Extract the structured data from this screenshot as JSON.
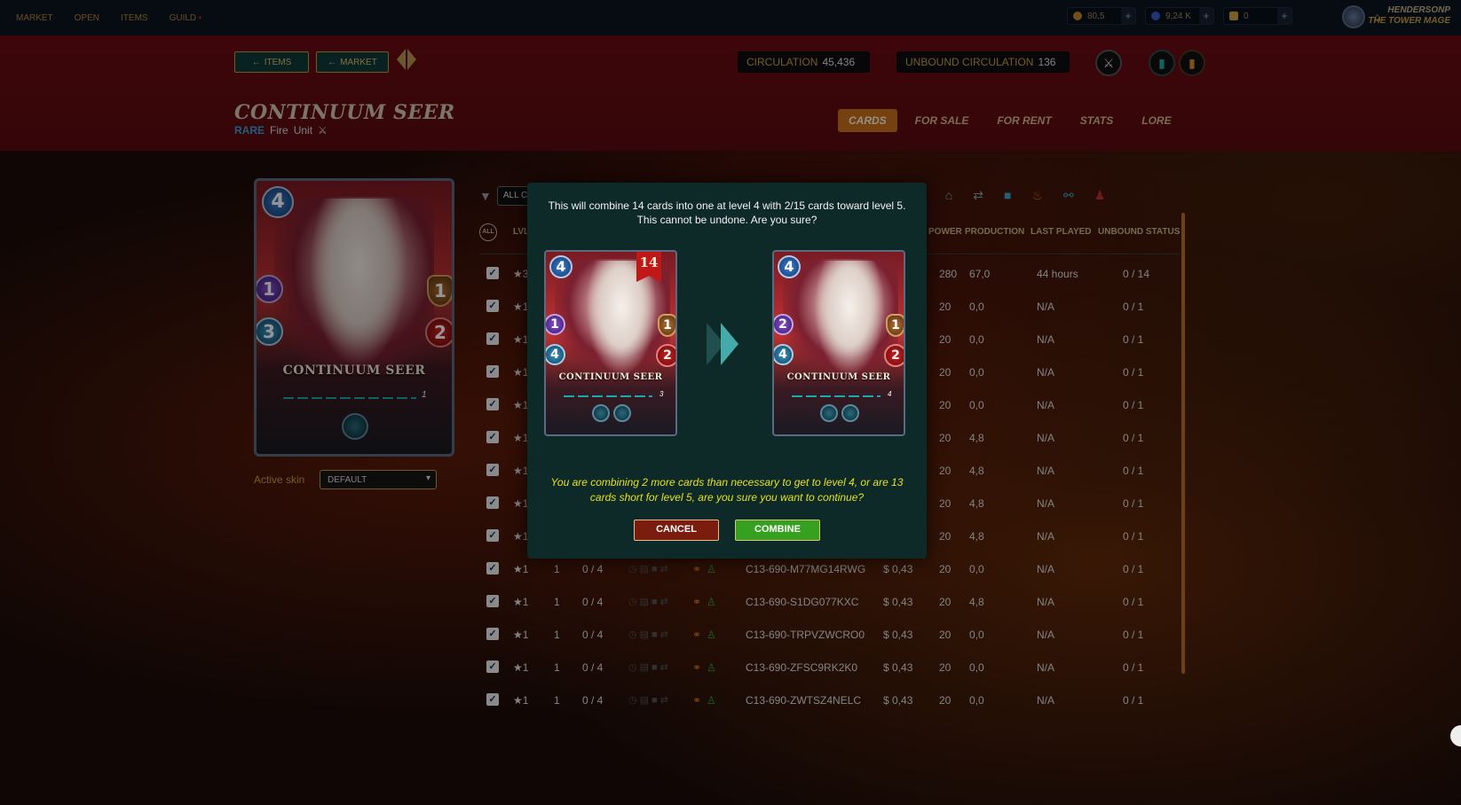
{
  "nav": {
    "items": [
      "MARKET",
      "OPEN",
      "ITEMS",
      "GUILD"
    ],
    "guild_dot": "•"
  },
  "currencies": [
    {
      "value": "80,5",
      "color": "#c8842a"
    },
    {
      "value": "9,24 K",
      "color": "#3a5ad0"
    },
    {
      "value": "0",
      "color": "#d0a040"
    }
  ],
  "user": {
    "name": "HENDERSONP",
    "title": "THE TOWER MAGE"
  },
  "header": {
    "items_button": "ITEMS",
    "market_button": "MARKET",
    "circulation_label": "CIRCULATION",
    "circulation_value": "45,436",
    "unbound_label": "UNBOUND CIRCULATION",
    "unbound_value": "136"
  },
  "card": {
    "name": "CONTINUUM SEER",
    "rarity": "RARE",
    "element": "Fire",
    "type": "Unit",
    "mana": "4",
    "magic": "1",
    "armor": "1",
    "health": "2",
    "speed": "3",
    "level": "1"
  },
  "tabs": [
    "CARDS",
    "FOR SALE",
    "FOR RENT",
    "STATS",
    "LORE"
  ],
  "active_tab": "CARDS",
  "skin": {
    "label": "Active skin",
    "value": "DEFAULT"
  },
  "table": {
    "filter_value": "ALL C",
    "all_label": "ALL",
    "columns": {
      "lvl": "LVL",
      "power": "POWER",
      "production": "PRODUCTION",
      "last_played": "LAST PLAYED",
      "unbound_status": "UNBOUND STATUS"
    },
    "rows": [
      {
        "stars": "★3",
        "lvl": "",
        "xp": "",
        "uid": "",
        "price": "",
        "power": "280",
        "production": "67,0",
        "last_played": "44 hours",
        "unbound": "0 / 14"
      },
      {
        "stars": "★1",
        "lvl": "",
        "xp": "",
        "uid": "",
        "price": "",
        "power": "20",
        "production": "0,0",
        "last_played": "N/A",
        "unbound": "0 / 1"
      },
      {
        "stars": "★1",
        "lvl": "",
        "xp": "",
        "uid": "",
        "price": "",
        "power": "20",
        "production": "0,0",
        "last_played": "N/A",
        "unbound": "0 / 1"
      },
      {
        "stars": "★1",
        "lvl": "",
        "xp": "",
        "uid": "",
        "price": "",
        "power": "20",
        "production": "0,0",
        "last_played": "N/A",
        "unbound": "0 / 1"
      },
      {
        "stars": "★1",
        "lvl": "",
        "xp": "",
        "uid": "",
        "price": "",
        "power": "20",
        "production": "0,0",
        "last_played": "N/A",
        "unbound": "0 / 1"
      },
      {
        "stars": "★1",
        "lvl": "",
        "xp": "",
        "uid": "",
        "price": "",
        "power": "20",
        "production": "4,8",
        "last_played": "N/A",
        "unbound": "0 / 1"
      },
      {
        "stars": "★1",
        "lvl": "",
        "xp": "",
        "uid": "",
        "price": "",
        "power": "20",
        "production": "4,8",
        "last_played": "N/A",
        "unbound": "0 / 1"
      },
      {
        "stars": "★1",
        "lvl": "",
        "xp": "",
        "uid": "",
        "price": "",
        "power": "20",
        "production": "4,8",
        "last_played": "N/A",
        "unbound": "0 / 1"
      },
      {
        "stars": "★1",
        "lvl": "",
        "xp": "",
        "uid": "",
        "price": "",
        "power": "20",
        "production": "4,8",
        "last_played": "N/A",
        "unbound": "0 / 1"
      },
      {
        "stars": "★1",
        "lvl": "1",
        "xp": "0 / 4",
        "uid": "C13-690-M77MG14RWG",
        "price": "$ 0,43",
        "power": "20",
        "production": "0,0",
        "last_played": "N/A",
        "unbound": "0 / 1"
      },
      {
        "stars": "★1",
        "lvl": "1",
        "xp": "0 / 4",
        "uid": "C13-690-S1DG077KXC",
        "price": "$ 0,43",
        "power": "20",
        "production": "4,8",
        "last_played": "N/A",
        "unbound": "0 / 1"
      },
      {
        "stars": "★1",
        "lvl": "1",
        "xp": "0 / 4",
        "uid": "C13-690-TRPVZWCRO0",
        "price": "$ 0,43",
        "power": "20",
        "production": "0,0",
        "last_played": "N/A",
        "unbound": "0 / 1"
      },
      {
        "stars": "★1",
        "lvl": "1",
        "xp": "0 / 4",
        "uid": "C13-690-ZFSC9RK2K0",
        "price": "$ 0,43",
        "power": "20",
        "production": "0,0",
        "last_played": "N/A",
        "unbound": "0 / 1"
      },
      {
        "stars": "★1",
        "lvl": "1",
        "xp": "0 / 4",
        "uid": "C13-690-ZWTSZ4NELC",
        "price": "$ 0,43",
        "power": "20",
        "production": "0,0",
        "last_played": "N/A",
        "unbound": "0 / 1"
      }
    ]
  },
  "modal": {
    "message": "This will combine 14 cards into one at level 4 with 2/15 cards toward level 5. This cannot be undone. Are you sure?",
    "from_card": {
      "count": "14",
      "mana": "4",
      "magic": "1",
      "armor": "1",
      "health": "2",
      "speed": "4",
      "name": "CONTINUUM SEER",
      "level": "3"
    },
    "to_card": {
      "mana": "4",
      "magic": "2",
      "armor": "1",
      "health": "2",
      "speed": "4",
      "name": "CONTINUUM SEER",
      "level": "4"
    },
    "warning": "You are combining 2 more cards than necessary to get to level 4, or are 13 cards short for level 5, are you sure you want to continue?",
    "cancel_label": "CANCEL",
    "combine_label": "COMBINE"
  }
}
